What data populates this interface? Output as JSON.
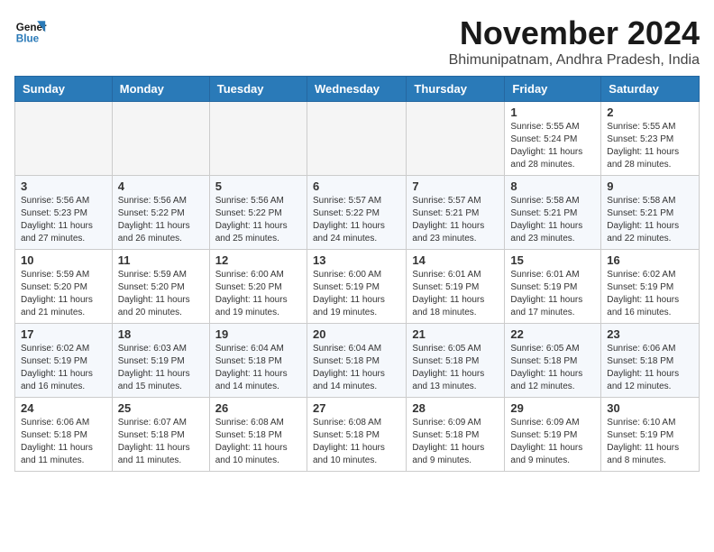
{
  "logo": {
    "line1": "General",
    "line2": "Blue"
  },
  "title": "November 2024",
  "location": "Bhimunipatnam, Andhra Pradesh, India",
  "days_of_week": [
    "Sunday",
    "Monday",
    "Tuesday",
    "Wednesday",
    "Thursday",
    "Friday",
    "Saturday"
  ],
  "weeks": [
    [
      {
        "num": "",
        "info": "",
        "empty": true
      },
      {
        "num": "",
        "info": "",
        "empty": true
      },
      {
        "num": "",
        "info": "",
        "empty": true
      },
      {
        "num": "",
        "info": "",
        "empty": true
      },
      {
        "num": "",
        "info": "",
        "empty": true
      },
      {
        "num": "1",
        "info": "Sunrise: 5:55 AM\nSunset: 5:24 PM\nDaylight: 11 hours\nand 28 minutes.",
        "empty": false
      },
      {
        "num": "2",
        "info": "Sunrise: 5:55 AM\nSunset: 5:23 PM\nDaylight: 11 hours\nand 28 minutes.",
        "empty": false
      }
    ],
    [
      {
        "num": "3",
        "info": "Sunrise: 5:56 AM\nSunset: 5:23 PM\nDaylight: 11 hours\nand 27 minutes.",
        "empty": false
      },
      {
        "num": "4",
        "info": "Sunrise: 5:56 AM\nSunset: 5:22 PM\nDaylight: 11 hours\nand 26 minutes.",
        "empty": false
      },
      {
        "num": "5",
        "info": "Sunrise: 5:56 AM\nSunset: 5:22 PM\nDaylight: 11 hours\nand 25 minutes.",
        "empty": false
      },
      {
        "num": "6",
        "info": "Sunrise: 5:57 AM\nSunset: 5:22 PM\nDaylight: 11 hours\nand 24 minutes.",
        "empty": false
      },
      {
        "num": "7",
        "info": "Sunrise: 5:57 AM\nSunset: 5:21 PM\nDaylight: 11 hours\nand 23 minutes.",
        "empty": false
      },
      {
        "num": "8",
        "info": "Sunrise: 5:58 AM\nSunset: 5:21 PM\nDaylight: 11 hours\nand 23 minutes.",
        "empty": false
      },
      {
        "num": "9",
        "info": "Sunrise: 5:58 AM\nSunset: 5:21 PM\nDaylight: 11 hours\nand 22 minutes.",
        "empty": false
      }
    ],
    [
      {
        "num": "10",
        "info": "Sunrise: 5:59 AM\nSunset: 5:20 PM\nDaylight: 11 hours\nand 21 minutes.",
        "empty": false
      },
      {
        "num": "11",
        "info": "Sunrise: 5:59 AM\nSunset: 5:20 PM\nDaylight: 11 hours\nand 20 minutes.",
        "empty": false
      },
      {
        "num": "12",
        "info": "Sunrise: 6:00 AM\nSunset: 5:20 PM\nDaylight: 11 hours\nand 19 minutes.",
        "empty": false
      },
      {
        "num": "13",
        "info": "Sunrise: 6:00 AM\nSunset: 5:19 PM\nDaylight: 11 hours\nand 19 minutes.",
        "empty": false
      },
      {
        "num": "14",
        "info": "Sunrise: 6:01 AM\nSunset: 5:19 PM\nDaylight: 11 hours\nand 18 minutes.",
        "empty": false
      },
      {
        "num": "15",
        "info": "Sunrise: 6:01 AM\nSunset: 5:19 PM\nDaylight: 11 hours\nand 17 minutes.",
        "empty": false
      },
      {
        "num": "16",
        "info": "Sunrise: 6:02 AM\nSunset: 5:19 PM\nDaylight: 11 hours\nand 16 minutes.",
        "empty": false
      }
    ],
    [
      {
        "num": "17",
        "info": "Sunrise: 6:02 AM\nSunset: 5:19 PM\nDaylight: 11 hours\nand 16 minutes.",
        "empty": false
      },
      {
        "num": "18",
        "info": "Sunrise: 6:03 AM\nSunset: 5:19 PM\nDaylight: 11 hours\nand 15 minutes.",
        "empty": false
      },
      {
        "num": "19",
        "info": "Sunrise: 6:04 AM\nSunset: 5:18 PM\nDaylight: 11 hours\nand 14 minutes.",
        "empty": false
      },
      {
        "num": "20",
        "info": "Sunrise: 6:04 AM\nSunset: 5:18 PM\nDaylight: 11 hours\nand 14 minutes.",
        "empty": false
      },
      {
        "num": "21",
        "info": "Sunrise: 6:05 AM\nSunset: 5:18 PM\nDaylight: 11 hours\nand 13 minutes.",
        "empty": false
      },
      {
        "num": "22",
        "info": "Sunrise: 6:05 AM\nSunset: 5:18 PM\nDaylight: 11 hours\nand 12 minutes.",
        "empty": false
      },
      {
        "num": "23",
        "info": "Sunrise: 6:06 AM\nSunset: 5:18 PM\nDaylight: 11 hours\nand 12 minutes.",
        "empty": false
      }
    ],
    [
      {
        "num": "24",
        "info": "Sunrise: 6:06 AM\nSunset: 5:18 PM\nDaylight: 11 hours\nand 11 minutes.",
        "empty": false
      },
      {
        "num": "25",
        "info": "Sunrise: 6:07 AM\nSunset: 5:18 PM\nDaylight: 11 hours\nand 11 minutes.",
        "empty": false
      },
      {
        "num": "26",
        "info": "Sunrise: 6:08 AM\nSunset: 5:18 PM\nDaylight: 11 hours\nand 10 minutes.",
        "empty": false
      },
      {
        "num": "27",
        "info": "Sunrise: 6:08 AM\nSunset: 5:18 PM\nDaylight: 11 hours\nand 10 minutes.",
        "empty": false
      },
      {
        "num": "28",
        "info": "Sunrise: 6:09 AM\nSunset: 5:18 PM\nDaylight: 11 hours\nand 9 minutes.",
        "empty": false
      },
      {
        "num": "29",
        "info": "Sunrise: 6:09 AM\nSunset: 5:19 PM\nDaylight: 11 hours\nand 9 minutes.",
        "empty": false
      },
      {
        "num": "30",
        "info": "Sunrise: 6:10 AM\nSunset: 5:19 PM\nDaylight: 11 hours\nand 8 minutes.",
        "empty": false
      }
    ]
  ]
}
